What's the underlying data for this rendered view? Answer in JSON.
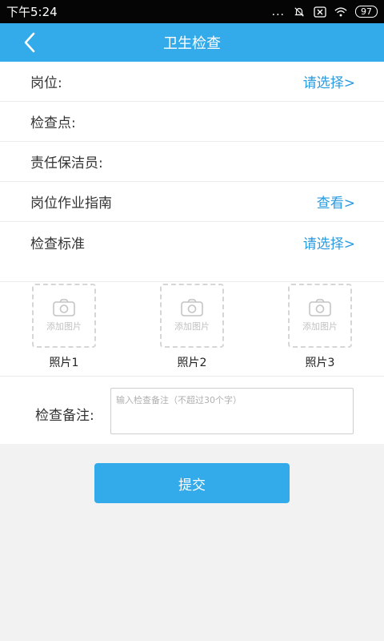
{
  "status_bar": {
    "time": "下午5:24",
    "dots": "...",
    "battery": "97"
  },
  "nav": {
    "title": "卫生检查"
  },
  "rows": [
    {
      "label": "岗位:",
      "action": "请选择>"
    },
    {
      "label": "检查点:",
      "action": ""
    },
    {
      "label": "责任保洁员:",
      "action": ""
    },
    {
      "label": "岗位作业指南",
      "action": "查看>"
    },
    {
      "label": "检查标准",
      "action": "请选择>"
    }
  ],
  "photos": [
    {
      "hint": "添加图片",
      "caption": "照片1"
    },
    {
      "hint": "添加图片",
      "caption": "照片2"
    },
    {
      "hint": "添加图片",
      "caption": "照片3"
    }
  ],
  "remark": {
    "label": "检查备注:",
    "placeholder": "输入检查备注（不超过30个字）"
  },
  "submit": {
    "label": "提交"
  },
  "colors": {
    "accent": "#33aae9",
    "link": "#2a9be0",
    "status_bar": "#050505"
  }
}
